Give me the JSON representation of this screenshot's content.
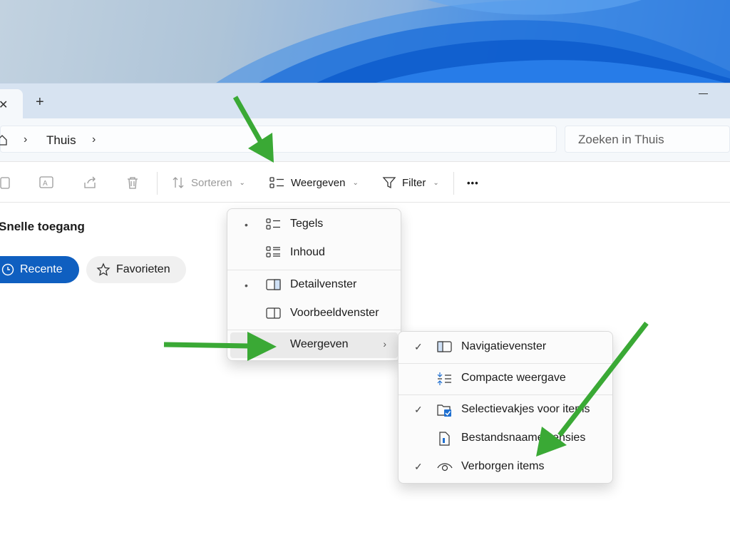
{
  "tabs": {
    "close_glyph": "✕",
    "new_tab_glyph": "+"
  },
  "address": {
    "breadcrumb": "Thuis",
    "chevron": "›"
  },
  "search": {
    "placeholder": "Zoeken in Thuis"
  },
  "toolbar": {
    "sort_label": "Sorteren",
    "view_label": "Weergeven",
    "filter_label": "Filter",
    "more_label": "•••",
    "caret": "⌄"
  },
  "quick_access": {
    "title": "Snelle toegang",
    "recent_label": "Recente",
    "favorites_label": "Favorieten"
  },
  "view_menu": {
    "items": [
      {
        "label": "Tegels",
        "bullet": "•",
        "icon": "tiles-icon"
      },
      {
        "label": "Inhoud",
        "bullet": "",
        "icon": "content-icon"
      },
      {
        "label": "Detailvenster",
        "bullet": "•",
        "icon": "details-pane-icon"
      },
      {
        "label": "Voorbeeldvenster",
        "bullet": "",
        "icon": "preview-pane-icon"
      },
      {
        "label": "Weergeven",
        "bullet": "",
        "submenu": "›"
      }
    ]
  },
  "show_submenu": {
    "items": [
      {
        "label": "Navigatievenster",
        "check": "✓",
        "icon": "navigation-pane-icon"
      },
      {
        "label": "Compacte weergave",
        "check": "",
        "icon": "compact-view-icon"
      },
      {
        "label": "Selectievakjes voor items",
        "check": "✓",
        "icon": "checkbox-icon"
      },
      {
        "label": "Bestandsnaamextensies",
        "check": "",
        "icon": "file-extension-icon"
      },
      {
        "label": "Verborgen items",
        "check": "✓",
        "icon": "eye-icon"
      }
    ]
  },
  "colors": {
    "accent": "#0f5fc0",
    "annotation_arrow": "#3aa935"
  }
}
